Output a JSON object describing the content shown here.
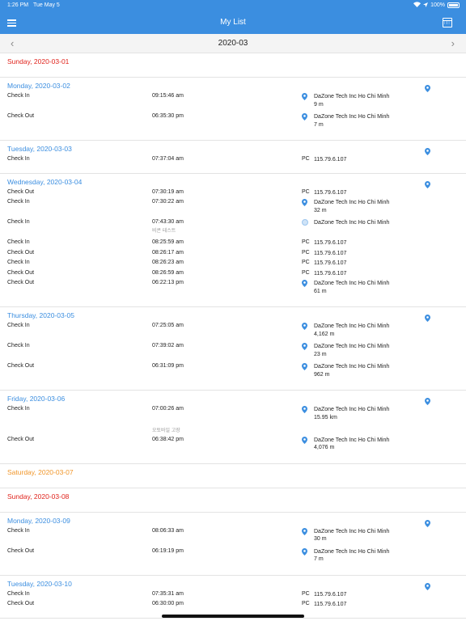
{
  "status": {
    "time": "1:26 PM",
    "date": "Tue May 5",
    "battery": "100%"
  },
  "nav": {
    "title": "My List"
  },
  "month": "2020-03",
  "days": [
    {
      "label": "Sunday, 2020-03-01",
      "color": "red",
      "pin": false,
      "rows": []
    },
    {
      "label": "Monday, 2020-03-02",
      "color": "blue",
      "pin": true,
      "rows": [
        {
          "type": "Check In",
          "time": "09:15:46 am",
          "src": "pin",
          "loc": "DaZone Tech Inc Ho Chi Minh",
          "dist": "9 m"
        },
        {
          "type": "Check Out",
          "time": "06:35:30 pm",
          "src": "pin",
          "loc": "DaZone Tech Inc Ho Chi Minh",
          "dist": "7 m"
        }
      ]
    },
    {
      "label": "Tuesday, 2020-03-03",
      "color": "blue",
      "pin": true,
      "rows": [
        {
          "type": "Check In",
          "time": "07:37:04 am",
          "src": "PC",
          "loc": "115.79.6.107"
        }
      ]
    },
    {
      "label": "Wednesday, 2020-03-04",
      "color": "blue",
      "pin": true,
      "rows": [
        {
          "type": "Check Out",
          "time": "07:30:19 am",
          "src": "PC",
          "loc": "115.79.6.107"
        },
        {
          "type": "Check In",
          "time": "07:30:22 am",
          "src": "pin",
          "loc": "DaZone Tech Inc Ho Chi Minh",
          "dist": "32 m"
        },
        {
          "type": "Check In",
          "time": "07:43:30 am",
          "note": "비콘 테스트",
          "src": "wifi",
          "loc": "DaZone Tech Inc Ho Chi Minh"
        },
        {
          "type": "Check In",
          "time": "08:25:59 am",
          "src": "PC",
          "loc": "115.79.6.107"
        },
        {
          "type": "Check Out",
          "time": "08:26:17 am",
          "src": "PC",
          "loc": "115.79.6.107"
        },
        {
          "type": "Check In",
          "time": "08:26:23 am",
          "src": "PC",
          "loc": "115.79.6.107"
        },
        {
          "type": "Check Out",
          "time": "08:26:59 am",
          "src": "PC",
          "loc": "115.79.6.107"
        },
        {
          "type": "Check Out",
          "time": "06:22:13 pm",
          "src": "pin",
          "loc": "DaZone Tech Inc Ho Chi Minh",
          "dist": "61 m"
        }
      ]
    },
    {
      "label": "Thursday, 2020-03-05",
      "color": "blue",
      "pin": true,
      "rows": [
        {
          "type": "Check In",
          "time": "07:25:05 am",
          "src": "pin",
          "loc": "DaZone Tech Inc Ho Chi Minh",
          "dist": "4,162 m"
        },
        {
          "type": "Check In",
          "time": "07:39:02 am",
          "src": "pin",
          "loc": "DaZone Tech Inc Ho Chi Minh",
          "dist": "23 m"
        },
        {
          "type": "Check Out",
          "time": "06:31:09 pm",
          "src": "pin",
          "loc": "DaZone Tech Inc Ho Chi Minh",
          "dist": "962 m"
        }
      ]
    },
    {
      "label": "Friday, 2020-03-06",
      "color": "blue",
      "pin": true,
      "rows": [
        {
          "type": "Check In",
          "time": "07:00:26 am",
          "src": "pin",
          "loc": "DaZone Tech Inc Ho Chi Minh",
          "dist": "15.95 km",
          "extra": "오토바일 고장"
        },
        {
          "type": "Check Out",
          "time": "06:38:42 pm",
          "src": "pin",
          "loc": "DaZone Tech Inc Ho Chi Minh",
          "dist": "4,076 m"
        }
      ]
    },
    {
      "label": "Saturday, 2020-03-07",
      "color": "orange",
      "pin": false,
      "rows": []
    },
    {
      "label": "Sunday, 2020-03-08",
      "color": "red",
      "pin": false,
      "rows": []
    },
    {
      "label": "Monday, 2020-03-09",
      "color": "blue",
      "pin": true,
      "rows": [
        {
          "type": "Check In",
          "time": "08:06:33 am",
          "src": "pin",
          "loc": "DaZone Tech Inc Ho Chi Minh",
          "dist": "30 m"
        },
        {
          "type": "Check Out",
          "time": "06:19:19 pm",
          "src": "pin",
          "loc": "DaZone Tech Inc Ho Chi Minh",
          "dist": "7 m"
        }
      ]
    },
    {
      "label": "Tuesday, 2020-03-10",
      "color": "blue",
      "pin": true,
      "rows": [
        {
          "type": "Check In",
          "time": "07:35:31 am",
          "src": "PC",
          "loc": "115.79.6.107"
        },
        {
          "type": "Check Out",
          "time": "06:30:00 pm",
          "src": "PC",
          "loc": "115.79.6.107"
        }
      ]
    }
  ],
  "colors": {
    "primary": "#3b8ee0",
    "sunday": "#e0241d",
    "saturday": "#f0962a"
  }
}
